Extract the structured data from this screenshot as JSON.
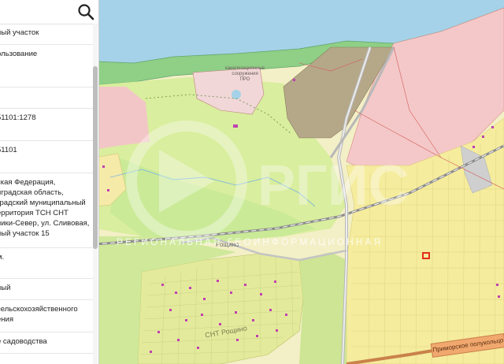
{
  "panel": {
    "search_icon": "magnifier-icon",
    "rows": [
      "ный участок",
      "ользование",
      "",
      "51101:1278",
      "51101",
      "ская Федерация,\nнградская область,\nградский муниципальный\nерритория ТСН СНТ\nники-Север, ул. Сливовая,\nный участок 15",
      "м.",
      "ный",
      "сельскохозяйственного\nения",
      "е садоводства"
    ]
  },
  "map": {
    "labels": {
      "sewer": "канализационные\nсооружения\nПРО",
      "rosch": "Рощино",
      "snt": "СНТ Рощино",
      "road": "Приморское полукольцо"
    },
    "watermark": "РЕГИОНАЛЬНАЯ ГЕОИНФОРМАЦИОННАЯ",
    "colors": {
      "sea": "#a5d2e8",
      "forest": "#b6e28e",
      "yellow": "#f3efc6",
      "pink": "#f4c8c8",
      "roads": "#b8b8b8",
      "highlight": "#e0301e"
    }
  }
}
